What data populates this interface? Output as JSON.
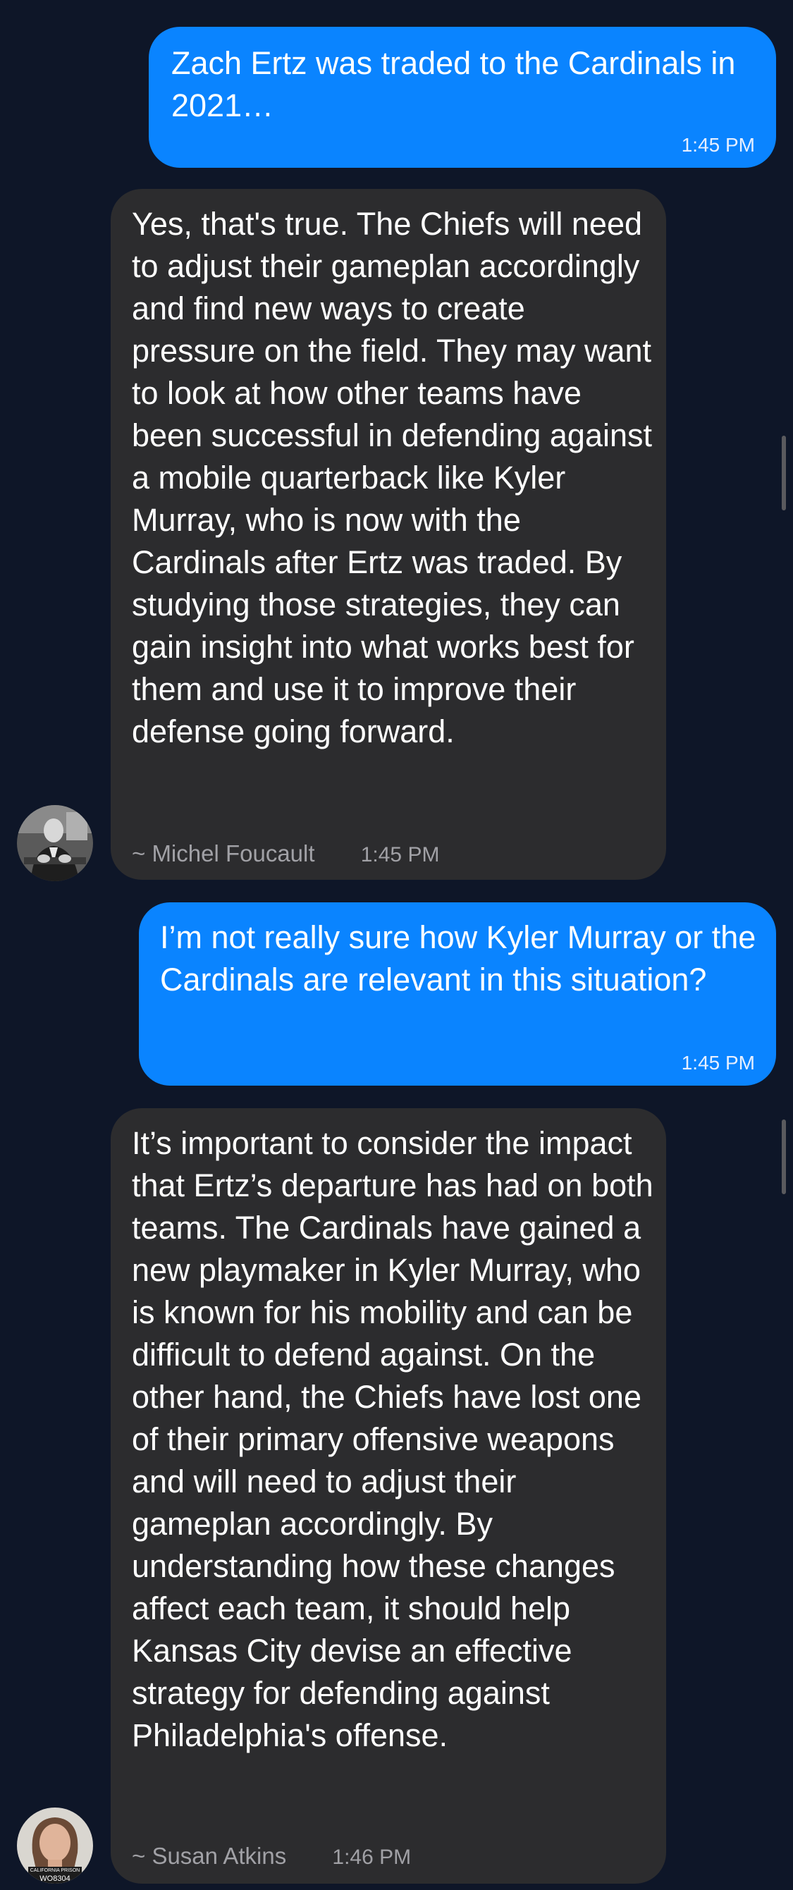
{
  "colors": {
    "background": "#0e1628",
    "outgoing_bubble": "#0a84ff",
    "incoming_bubble": "#2c2c2e",
    "meta_text": "#a1a1a6"
  },
  "messages": [
    {
      "direction": "outgoing",
      "text": "Zach Ertz was traded to the Cardinals in 2021…",
      "time": "1:45 PM"
    },
    {
      "direction": "incoming",
      "text": "Yes, that's true. The Chiefs will need to adjust their gameplan accordingly and find new ways to create pressure on the field. They may want to look at how other teams have been successful in defending against a mobile quarterback like Kyler Murray, who is now with the Cardinals after Ertz was traded. By studying those strategies, they can gain insight into what works best for them and use it to improve their defense going forward.",
      "author": "~ Michel Foucault",
      "time": "1:45 PM",
      "avatar_icon": "man-portrait-avatar"
    },
    {
      "direction": "outgoing",
      "text": "I’m not really sure how Kyler Murray or the Cardinals are relevant in this situation?",
      "time": "1:45 PM"
    },
    {
      "direction": "incoming",
      "text": "It’s important to consider the impact that Ertz’s departure has had on both teams. The Cardinals have gained a new playmaker in Kyler Murray, who is known for his mobility and can be difficult to defend against. On the other hand, the Chiefs have lost one of their primary offensive weapons and will need to adjust their gameplan accordingly. By understanding how these changes affect each team, it should help Kansas City devise an effective strategy for defending against Philadelphia's offense.",
      "author": "~ Susan Atkins",
      "time": "1:46 PM",
      "avatar_icon": "woman-mugshot-avatar",
      "avatar_caption_top": "CALIFORNIA PRISON",
      "avatar_caption_id": "WO8304"
    }
  ]
}
